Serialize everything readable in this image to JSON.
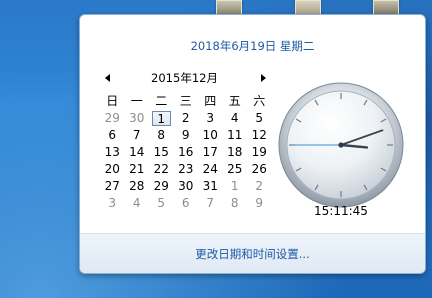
{
  "flyout": {
    "current_date": "2018年6月19日 星期二",
    "change_settings_link": "更改日期和时间设置...",
    "calendar": {
      "month_title": "2015年12月",
      "weekdays": [
        "日",
        "一",
        "二",
        "三",
        "四",
        "五",
        "六"
      ],
      "weeks": [
        [
          "29",
          "30",
          "1",
          "2",
          "3",
          "4",
          "5"
        ],
        [
          "6",
          "7",
          "8",
          "9",
          "10",
          "11",
          "12"
        ],
        [
          "13",
          "14",
          "15",
          "16",
          "17",
          "18",
          "19"
        ],
        [
          "20",
          "21",
          "22",
          "23",
          "24",
          "25",
          "26"
        ],
        [
          "27",
          "28",
          "29",
          "30",
          "31",
          "1",
          "2"
        ],
        [
          "3",
          "4",
          "5",
          "6",
          "7",
          "8",
          "9"
        ]
      ],
      "selected_day": "1"
    },
    "clock": {
      "time": "15:11:45"
    }
  },
  "colors": {
    "link_blue": "#1e5aa8",
    "desktop_blue": "#2a79c8"
  }
}
